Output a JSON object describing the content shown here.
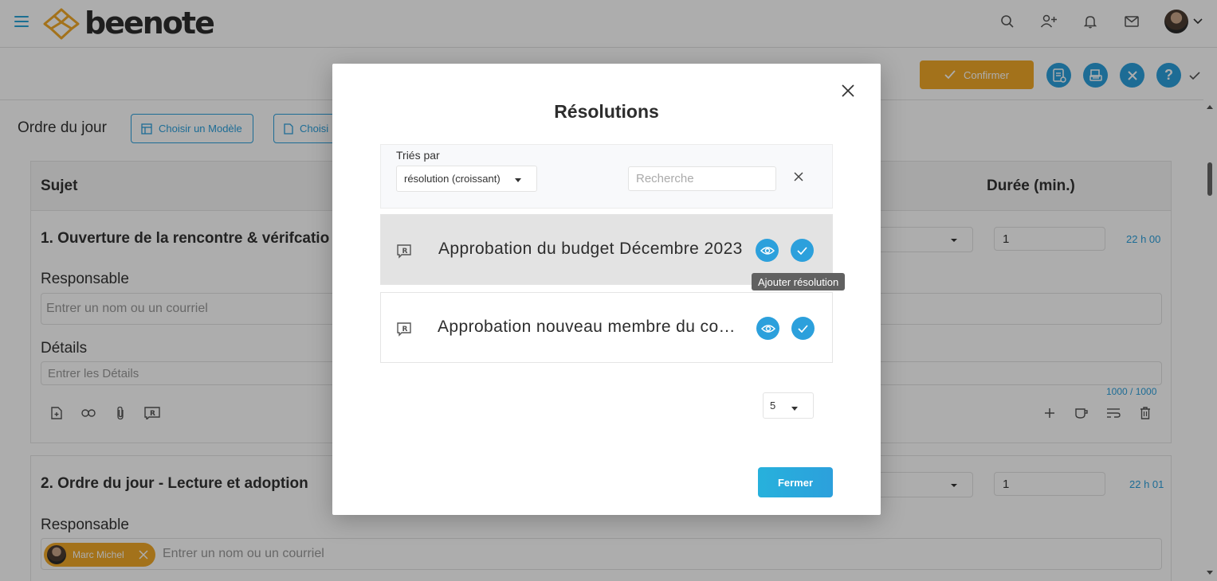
{
  "brand": {
    "name": "beenote"
  },
  "header": {
    "icons": [
      "search-icon",
      "add-user-icon",
      "bell-icon",
      "mail-icon",
      "avatar",
      "chevron-down-icon"
    ]
  },
  "toolbar": {
    "confirm_label": "Confirmer",
    "buttons": [
      "document-settings-icon",
      "print-icon",
      "close-icon",
      "help-icon"
    ],
    "help_glyph": "?"
  },
  "agenda": {
    "title": "Ordre du jour",
    "choose_template_label": "Choisir un Modèle",
    "choose_other_label": "Choisi",
    "columns": {
      "subject": "Sujet",
      "duration": "Durée (min.)"
    },
    "items": [
      {
        "number": "1.",
        "title": "Ouverture de la rencontre & vérifcatio",
        "responsible_label": "Responsable",
        "responsible_placeholder": "Entrer un nom ou un courriel",
        "details_label": "Détails",
        "details_placeholder": "Entrer les Détails",
        "duration": "1",
        "time": "22 h 00",
        "char_counter": "1000 / 1000"
      },
      {
        "number": "2.",
        "title": "Ordre du jour - Lecture et adoption",
        "responsible_label": "Responsable",
        "responsible_placeholder": "Entrer un nom ou un courriel",
        "chip_name": "Marc Michel",
        "duration": "1",
        "time": "22 h 01"
      }
    ]
  },
  "modal": {
    "title": "Résolutions",
    "sort_label": "Triés par",
    "sort_value": "résolution (croissant)",
    "search_placeholder": "Recherche",
    "resolutions": [
      {
        "title": "Approbation du budget Décembre 2023",
        "state": "hovered"
      },
      {
        "title": "Approbation nouveau membre du conseil",
        "state": "normal"
      }
    ],
    "tooltip": "Ajouter résolution",
    "page_size": "5",
    "close_label": "Fermer"
  },
  "colors": {
    "accent": "#2ca0dc",
    "confirm": "#f0a928",
    "overlay": "rgba(0,0,0,0.32)"
  }
}
